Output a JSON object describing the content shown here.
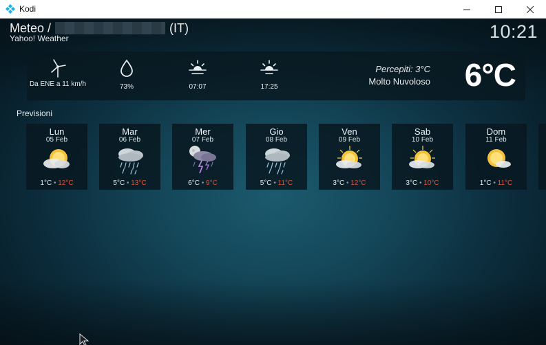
{
  "window": {
    "title": "Kodi"
  },
  "header": {
    "title_prefix": "Meteo /",
    "title_suffix": "(IT)",
    "subtitle": "Yahoo! Weather",
    "clock": "10:21"
  },
  "current": {
    "wind": "Da ENE a 11 km/h",
    "humidity": "73%",
    "sunrise": "07:07",
    "sunset": "17:25",
    "feels_like": "Percepiti: 3°C",
    "condition": "Molto Nuvoloso",
    "temperature": "6°C"
  },
  "forecast": {
    "label": "Previsioni",
    "days": [
      {
        "day": "Lun",
        "date": "05 Feb",
        "low": "1°C",
        "high": "12°C",
        "icon": "partly-cloudy-sun"
      },
      {
        "day": "Mar",
        "date": "06 Feb",
        "low": "5°C",
        "high": "13°C",
        "icon": "rain-cloud"
      },
      {
        "day": "Mer",
        "date": "07 Feb",
        "low": "6°C",
        "high": "9°C",
        "icon": "thunderstorm-night"
      },
      {
        "day": "Gio",
        "date": "08 Feb",
        "low": "5°C",
        "high": "11°C",
        "icon": "rain-cloud"
      },
      {
        "day": "Ven",
        "date": "09 Feb",
        "low": "3°C",
        "high": "12°C",
        "icon": "partly-cloudy-sun"
      },
      {
        "day": "Sab",
        "date": "10 Feb",
        "low": "3°C",
        "high": "10°C",
        "icon": "partly-cloudy-sun"
      },
      {
        "day": "Dom",
        "date": "11 Feb",
        "low": "1°C",
        "high": "11°C",
        "icon": "partly-cloudy-sun"
      }
    ]
  },
  "colors": {
    "high_temp": "#e0553b",
    "panel": "#081820",
    "background_center": "#1c5a6e"
  }
}
